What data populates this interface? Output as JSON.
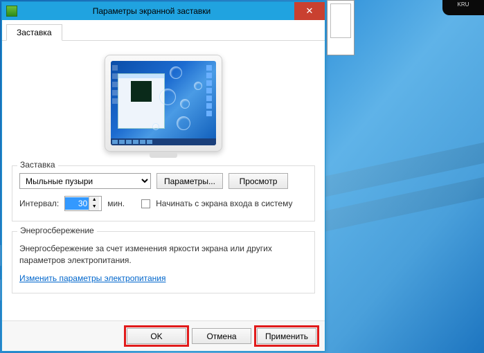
{
  "window": {
    "title": "Параметры экранной заставки",
    "close_glyph": "✕"
  },
  "tab": {
    "label": "Заставка"
  },
  "group_saver": {
    "legend": "Заставка",
    "dropdown_value": "Мыльные пузыри",
    "settings_btn": "Параметры...",
    "preview_btn": "Просмотр",
    "interval_label": "Интервал:",
    "interval_value": "30",
    "interval_unit": "мин.",
    "lock_checkbox": "Начинать с экрана входа в систему"
  },
  "group_power": {
    "legend": "Энергосбережение",
    "description": "Энергосбережение за счет изменения яркости экрана или других параметров электропитания.",
    "link": "Изменить параметры электропитания"
  },
  "footer": {
    "ok": "OK",
    "cancel": "Отмена",
    "apply": "Применить"
  },
  "desktop": {
    "device_text": "KRU"
  }
}
